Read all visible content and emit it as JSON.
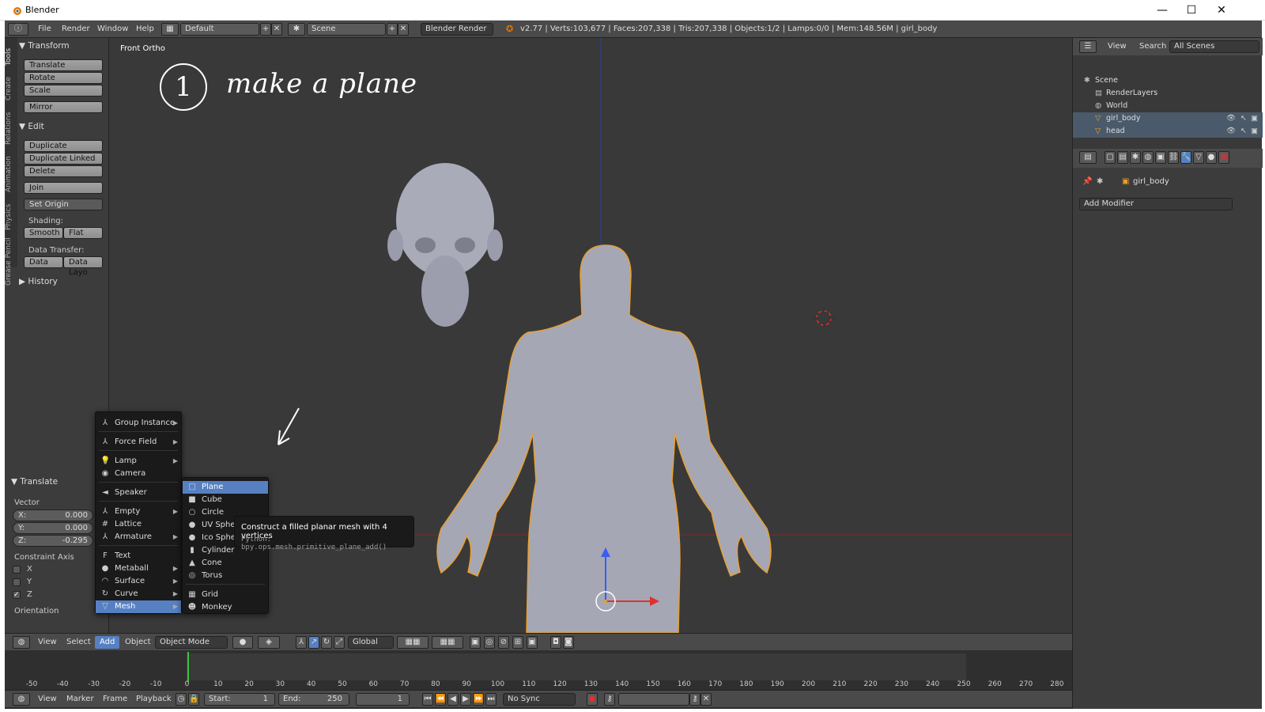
{
  "window": {
    "title": "Blender",
    "minimize": "—",
    "maximize": "☐",
    "close": "✕"
  },
  "info_header": {
    "menus": [
      "File",
      "Render",
      "Window",
      "Help"
    ],
    "layout": "Default",
    "scene": "Scene",
    "engine": "Blender Render",
    "stats": "v2.77 | Verts:103,677 | Faces:207,338 | Tris:207,338 | Objects:1/2 | Lamps:0/0 | Mem:148.56M | girl_body"
  },
  "tool_tabs": [
    "Tools",
    "Create",
    "Relations",
    "Animation",
    "Physics",
    "Grease Pencil"
  ],
  "tool_shelf": {
    "transform_header": "Transform",
    "translate": "Translate",
    "rotate": "Rotate",
    "scale": "Scale",
    "mirror": "Mirror",
    "edit_header": "Edit",
    "duplicate": "Duplicate",
    "duplicate_linked": "Duplicate Linked",
    "delete": "Delete",
    "join": "Join",
    "set_origin": "Set Origin",
    "shading_label": "Shading:",
    "smooth": "Smooth",
    "flat": "Flat",
    "data_transfer_label": "Data Transfer:",
    "data": "Data",
    "data_layo": "Data Layo",
    "history_header": "History"
  },
  "operator_panel": {
    "header": "Translate",
    "vector_label": "Vector",
    "x": "X:",
    "x_val": "0.000",
    "y": "Y:",
    "y_val": "0.000",
    "z": "Z:",
    "z_val": "-0.295",
    "constraint_label": "Constraint Axis",
    "cx": "X",
    "cy": "Y",
    "cz": "Z",
    "orientation": "Orientation"
  },
  "viewport": {
    "label": "Front Ortho",
    "hand_number": "1",
    "hand_text": "make a plane"
  },
  "add_menu": {
    "items": [
      {
        "label": "Group Instance",
        "icon": "⅄",
        "sub": true
      },
      {
        "label": "Force Field",
        "icon": "⅄",
        "sub": true
      },
      {
        "label": "Lamp",
        "icon": "💡",
        "sub": true
      },
      {
        "label": "Camera",
        "icon": "◉",
        "sub": false
      },
      {
        "label": "Speaker",
        "icon": "◄",
        "sub": false
      },
      {
        "label": "Empty",
        "icon": "⅄",
        "sub": true
      },
      {
        "label": "Lattice",
        "icon": "#",
        "sub": false
      },
      {
        "label": "Armature",
        "icon": "⅄",
        "sub": true
      },
      {
        "label": "Text",
        "icon": "F",
        "sub": false
      },
      {
        "label": "Metaball",
        "icon": "●",
        "sub": true
      },
      {
        "label": "Surface",
        "icon": "◠",
        "sub": true
      },
      {
        "label": "Curve",
        "icon": "↻",
        "sub": true
      },
      {
        "label": "Mesh",
        "icon": "▽",
        "sub": true
      }
    ]
  },
  "mesh_menu": {
    "items": [
      {
        "label": "Plane",
        "icon": "□"
      },
      {
        "label": "Cube",
        "icon": "■"
      },
      {
        "label": "Circle",
        "icon": "○"
      },
      {
        "label": "UV Sphe",
        "icon": "●"
      },
      {
        "label": "Ico Sphere",
        "icon": "●"
      },
      {
        "label": "Cylinder",
        "icon": "▮"
      },
      {
        "label": "Cone",
        "icon": "▲"
      },
      {
        "label": "Torus",
        "icon": "◎"
      },
      {
        "label": "Grid",
        "icon": "▦"
      },
      {
        "label": "Monkey",
        "icon": "☻"
      }
    ]
  },
  "tooltip": {
    "title": "Construct a filled planar mesh with 4 vertices",
    "python": "Python: bpy.ops.mesh.primitive_plane_add()"
  },
  "view_header": {
    "view": "View",
    "select": "Select",
    "add": "Add",
    "object": "Object",
    "mode": "Object Mode",
    "orientation": "Global"
  },
  "timeline": {
    "ticks": [
      "-50",
      "-40",
      "-30",
      "-20",
      "-10",
      "0",
      "10",
      "20",
      "30",
      "40",
      "50",
      "60",
      "70",
      "80",
      "90",
      "100",
      "110",
      "120",
      "130",
      "140",
      "150",
      "160",
      "170",
      "180",
      "190",
      "200",
      "210",
      "220",
      "230",
      "240",
      "250",
      "260",
      "270",
      "280"
    ],
    "view": "View",
    "marker": "Marker",
    "frame": "Frame",
    "playback": "Playback",
    "start_label": "Start:",
    "start": "1",
    "end_label": "End:",
    "end": "250",
    "current": "1",
    "sync": "No Sync"
  },
  "outliner": {
    "view": "View",
    "search": "Search",
    "scope": "All Scenes",
    "rows": [
      {
        "label": "Scene",
        "indent": 0
      },
      {
        "label": "RenderLayers",
        "indent": 1
      },
      {
        "label": "World",
        "indent": 1
      },
      {
        "label": "girl_body",
        "indent": 1
      },
      {
        "label": "head",
        "indent": 1
      }
    ]
  },
  "properties": {
    "object_name": "girl_body",
    "add_modifier": "Add Modifier"
  },
  "colors": {
    "accent": "#5680c2",
    "selected_outline": "#e8a030"
  }
}
